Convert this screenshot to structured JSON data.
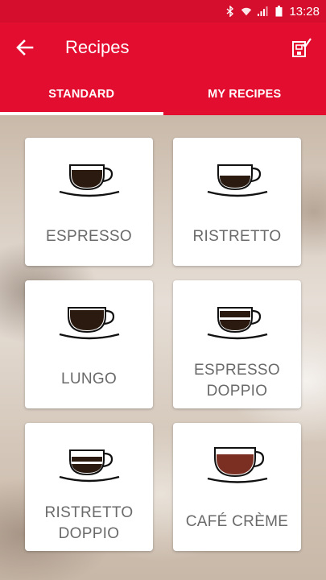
{
  "status_bar": {
    "time": "13:28"
  },
  "app_bar": {
    "title": "Recipes"
  },
  "tabs": [
    {
      "label": "STANDARD",
      "selected": true
    },
    {
      "label": "MY RECIPES",
      "selected": false
    }
  ],
  "recipes": [
    {
      "name": "ESPRESSO",
      "cup": "espresso-cup-icon"
    },
    {
      "name": "RISTRETTO",
      "cup": "ristretto-cup-icon"
    },
    {
      "name": "LUNGO",
      "cup": "lungo-cup-icon"
    },
    {
      "name_line1": "ESPRESSO",
      "name_line2": "DOPPIO",
      "cup": "espresso-doppio-cup-icon"
    },
    {
      "name_line1": "RISTRETTO",
      "name_line2": "DOPPIO",
      "cup": "ristretto-doppio-cup-icon"
    },
    {
      "name": "CAFÉ CRÈME",
      "cup": "cafe-creme-cup-icon"
    }
  ],
  "colors": {
    "brand_red": "#e30d2f",
    "coffee_dark": "#2a1a10",
    "cafe_creme": "#7a2f22"
  }
}
